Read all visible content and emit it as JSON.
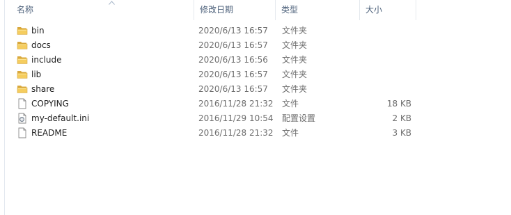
{
  "columns": {
    "name": "名称",
    "date": "修改日期",
    "type": "类型",
    "size": "大小"
  },
  "files": [
    {
      "name": "bin",
      "date": "2020/6/13 16:57",
      "type": "文件夹",
      "size": "",
      "icon": "folder-icon"
    },
    {
      "name": "docs",
      "date": "2020/6/13 16:57",
      "type": "文件夹",
      "size": "",
      "icon": "folder-icon"
    },
    {
      "name": "include",
      "date": "2020/6/13 16:56",
      "type": "文件夹",
      "size": "",
      "icon": "folder-icon"
    },
    {
      "name": "lib",
      "date": "2020/6/13 16:57",
      "type": "文件夹",
      "size": "",
      "icon": "folder-icon"
    },
    {
      "name": "share",
      "date": "2020/6/13 16:57",
      "type": "文件夹",
      "size": "",
      "icon": "folder-icon"
    },
    {
      "name": "COPYING",
      "date": "2016/11/28 21:32",
      "type": "文件",
      "size": "18 KB",
      "icon": "file-icon"
    },
    {
      "name": "my-default.ini",
      "date": "2016/11/29 10:54",
      "type": "配置设置",
      "size": "2 KB",
      "icon": "settings-file-icon"
    },
    {
      "name": "README",
      "date": "2016/11/28 21:32",
      "type": "文件",
      "size": "3 KB",
      "icon": "file-icon"
    }
  ]
}
